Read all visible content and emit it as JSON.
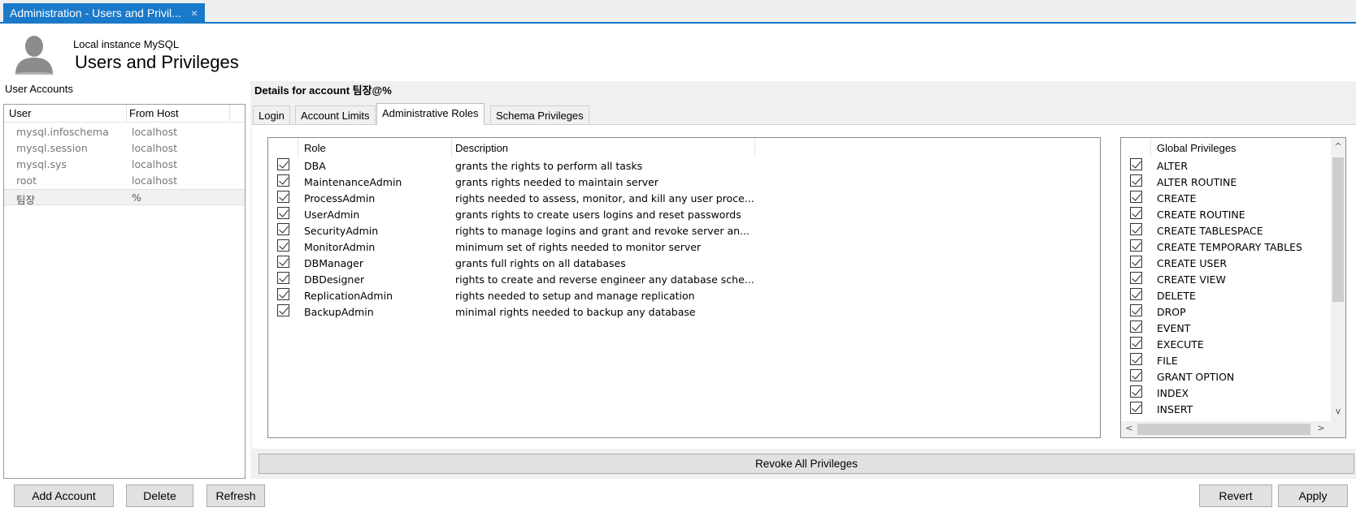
{
  "window": {
    "tab_title": "Administration - Users and Privil...",
    "close_glyph": "×"
  },
  "header": {
    "subtitle": "Local instance MySQL",
    "title": "Users and Privileges",
    "avatar_icon": "user-avatar-icon"
  },
  "user_accounts": {
    "label": "User Accounts",
    "columns": [
      "User",
      "From Host"
    ],
    "rows": [
      {
        "user": "mysql.infoschema",
        "host": "localhost"
      },
      {
        "user": "mysql.session",
        "host": "localhost"
      },
      {
        "user": "mysql.sys",
        "host": "localhost"
      },
      {
        "user": "root",
        "host": "localhost"
      },
      {
        "user": "팀장",
        "host": "%"
      }
    ],
    "selected_index": 4
  },
  "details": {
    "heading": "Details for account 팀장@%",
    "tabs": [
      "Login",
      "Account Limits",
      "Administrative Roles",
      "Schema Privileges"
    ],
    "active_tab": "Administrative Roles"
  },
  "roles": {
    "columns": [
      "Role",
      "Description"
    ],
    "rows": [
      {
        "role": "DBA",
        "description": "grants the rights to perform all tasks",
        "checked": true
      },
      {
        "role": "MaintenanceAdmin",
        "description": "grants rights needed to maintain server",
        "checked": true
      },
      {
        "role": "ProcessAdmin",
        "description": "rights needed to assess, monitor, and kill any user proce...",
        "checked": true
      },
      {
        "role": "UserAdmin",
        "description": "grants rights to create users logins and reset passwords",
        "checked": true
      },
      {
        "role": "SecurityAdmin",
        "description": "rights to manage logins and grant and revoke server an...",
        "checked": true
      },
      {
        "role": "MonitorAdmin",
        "description": "minimum set of rights needed to monitor server",
        "checked": true
      },
      {
        "role": "DBManager",
        "description": "grants full rights on all databases",
        "checked": true
      },
      {
        "role": "DBDesigner",
        "description": "rights to create and reverse engineer any database sche...",
        "checked": true
      },
      {
        "role": "ReplicationAdmin",
        "description": "rights needed to setup and manage replication",
        "checked": true
      },
      {
        "role": "BackupAdmin",
        "description": "minimal rights needed to backup any database",
        "checked": true
      }
    ]
  },
  "global_privileges": {
    "header": "Global Privileges",
    "items": [
      "ALTER",
      "ALTER ROUTINE",
      "CREATE",
      "CREATE ROUTINE",
      "CREATE TABLESPACE",
      "CREATE TEMPORARY TABLES",
      "CREATE USER",
      "CREATE VIEW",
      "DELETE",
      "DROP",
      "EVENT",
      "EXECUTE",
      "FILE",
      "GRANT OPTION",
      "INDEX",
      "INSERT"
    ],
    "scroll_up": "^",
    "scroll_down": "v",
    "scroll_left": "<",
    "scroll_right": ">"
  },
  "buttons": {
    "revoke_all": "Revoke All Privileges",
    "add_account": "Add Account",
    "delete": "Delete",
    "refresh": "Refresh",
    "revert": "Revert",
    "apply": "Apply"
  },
  "colors": {
    "accent": "#1979ca",
    "panel_bg": "#f0f0f0",
    "button_bg": "#e1e1e1"
  }
}
